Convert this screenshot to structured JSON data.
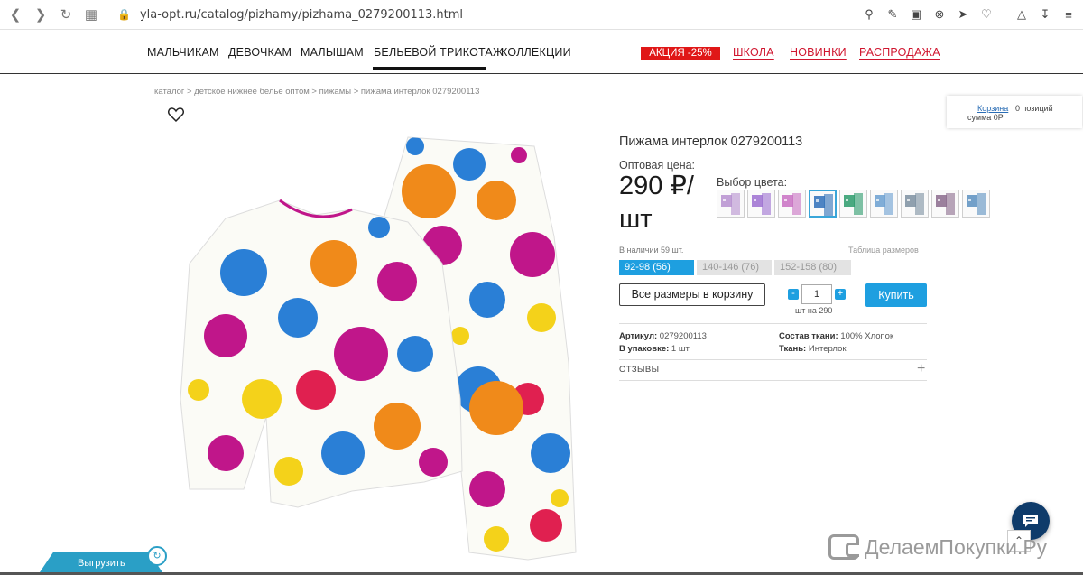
{
  "browser": {
    "url": "yla-opt.ru/catalog/pizhamy/pizhama_0279200113.html",
    "icons": [
      "zoom-icon",
      "edit-icon",
      "camera-icon",
      "block-icon",
      "send-icon",
      "heart-icon",
      "box-icon",
      "download-icon",
      "menu-icon"
    ]
  },
  "nav": {
    "left": [
      "МАЛЬЧИКАМ",
      "ДЕВОЧКАМ",
      "МАЛЫШАМ",
      "БЕЛЬЕВОЙ ТРИКОТАЖ",
      "КОЛЛЕКЦИИ"
    ],
    "sale": "АКЦИЯ -25%",
    "right": [
      "ШКОЛА",
      "НОВИНКИ",
      "РАСПРОДАЖА"
    ]
  },
  "breadcrumbs": [
    "каталог",
    ">",
    "детское нижнее белье оптом",
    ">",
    "пижамы",
    ">",
    "пижама интерлок 0279200113"
  ],
  "cart": {
    "label": "Корзина",
    "positions": "0 позиций",
    "sum": "сумма 0Р"
  },
  "product": {
    "title": "Пижама интерлок 0279200113",
    "price_label": "Оптовая цена:",
    "price": "290 ₽/ шт",
    "colors_label": "Выбор цвета:",
    "swatch_colors": [
      "#b68fcf",
      "#9c6fd0",
      "#c86fc2",
      "#2e6fb8",
      "#2a9a6a",
      "#6a9fd0",
      "#7c8fa0",
      "#8a6a8c",
      "#5a8fbf"
    ],
    "selected_swatch": 3,
    "stock": "В наличии 59 шт.",
    "size_table": "Таблица размеров",
    "sizes": [
      "92-98 (56)",
      "140-146 (76)",
      "152-158 (80)"
    ],
    "all_sizes_button": "Все размеры в корзину",
    "qty": "1",
    "minus": "-",
    "plus": "+",
    "per_unit": "шт на 290",
    "buy_button": "Купить",
    "article_label": "Артикул:",
    "article": "0279200113",
    "pack_label": "В упаковке:",
    "pack": "1 шт",
    "composition_label": "Состав ткани:",
    "composition": "100% Хлопок",
    "fabric_label": "Ткань:",
    "fabric": "Интерлок",
    "reviews": "ОТЗЫВЫ",
    "reviews_toggle": "+"
  },
  "widgets": {
    "export": "Выгрузить",
    "watermark": "ДелаемПокупки.Ру"
  }
}
